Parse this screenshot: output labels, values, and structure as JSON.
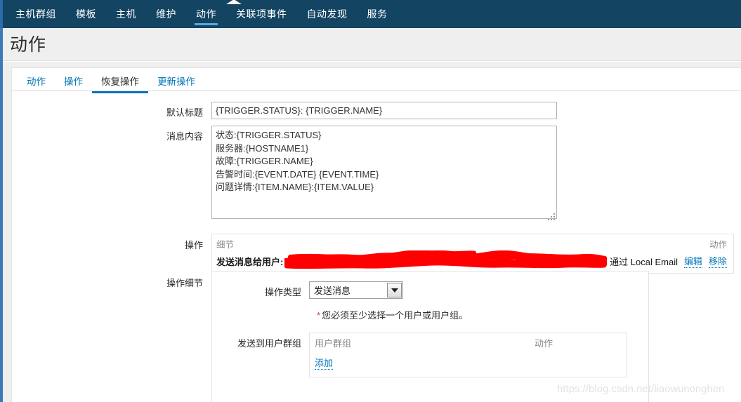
{
  "navbar": {
    "items": [
      {
        "label": "主机群组",
        "active": false
      },
      {
        "label": "模板",
        "active": false
      },
      {
        "label": "主机",
        "active": false
      },
      {
        "label": "维护",
        "active": false
      },
      {
        "label": "动作",
        "active": true
      },
      {
        "label": "关联项事件",
        "active": false
      },
      {
        "label": "自动发现",
        "active": false
      },
      {
        "label": "服务",
        "active": false
      }
    ]
  },
  "header": {
    "title": "动作"
  },
  "tabs": [
    {
      "label": "动作",
      "active": false
    },
    {
      "label": "操作",
      "active": false
    },
    {
      "label": "恢复操作",
      "active": true
    },
    {
      "label": "更新操作",
      "active": false
    }
  ],
  "form": {
    "subject": {
      "label": "默认标题",
      "value": "{TRIGGER.STATUS}: {TRIGGER.NAME}"
    },
    "message": {
      "label": "消息内容",
      "value": "状态:{TRIGGER.STATUS}\n服务器:{HOSTNAME1}\n故障:{TRIGGER.NAME}\n告警时间:{EVENT.DATE} {EVENT.TIME}\n问题详情:{ITEM.NAME}:{ITEM.VALUE}"
    },
    "operations": {
      "label": "操作",
      "col_details": "细节",
      "col_action": "动作",
      "row": {
        "prefix": "发送消息给用户:",
        "redacted": true,
        "via": "通过 Local Email",
        "edit_label": "编辑",
        "remove_label": "移除"
      }
    },
    "operation_detail": {
      "label": "操作细节",
      "operation_type": {
        "label": "操作类型",
        "value": "发送消息",
        "options": [
          "发送消息"
        ]
      },
      "warning": {
        "star": "*",
        "text": "您必须至少选择一个用户或用户组。"
      },
      "send_to_user_groups": {
        "label": "发送到用户群组",
        "col_group": "用户群组",
        "col_action": "动作",
        "add_label": "添加"
      }
    }
  },
  "watermark": {
    "text": "https://blog.csdn.net/liaowunonghen"
  },
  "colors": {
    "navbar_bg": "#134462",
    "nav_active_underline": "#5aa8e0",
    "link": "#0275b8",
    "page_bg": "#efefef",
    "redaction": "#ff0000",
    "warning_star": "#d43f3a"
  }
}
